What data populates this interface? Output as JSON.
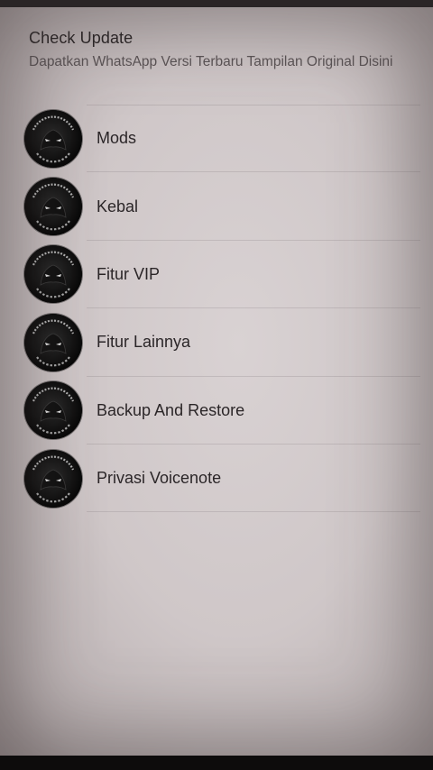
{
  "header": {
    "title": "Check Update",
    "subtitle": "Dapatkan WhatsApp Versi Terbaru Tampilan Original Disini"
  },
  "menu": {
    "items": [
      {
        "label": "Mods",
        "icon": "whatsapp-mods-logo-icon"
      },
      {
        "label": "Kebal",
        "icon": "whatsapp-mods-logo-icon"
      },
      {
        "label": "Fitur VIP",
        "icon": "whatsapp-mods-logo-icon"
      },
      {
        "label": "Fitur Lainnya",
        "icon": "whatsapp-mods-logo-icon"
      },
      {
        "label": "Backup And Restore",
        "icon": "whatsapp-mods-logo-icon"
      },
      {
        "label": "Privasi Voicenote",
        "icon": "whatsapp-mods-logo-icon"
      }
    ]
  },
  "colors": {
    "background": "#d4cccd",
    "text_primary": "#2b2628",
    "text_secondary": "#5c5557"
  }
}
